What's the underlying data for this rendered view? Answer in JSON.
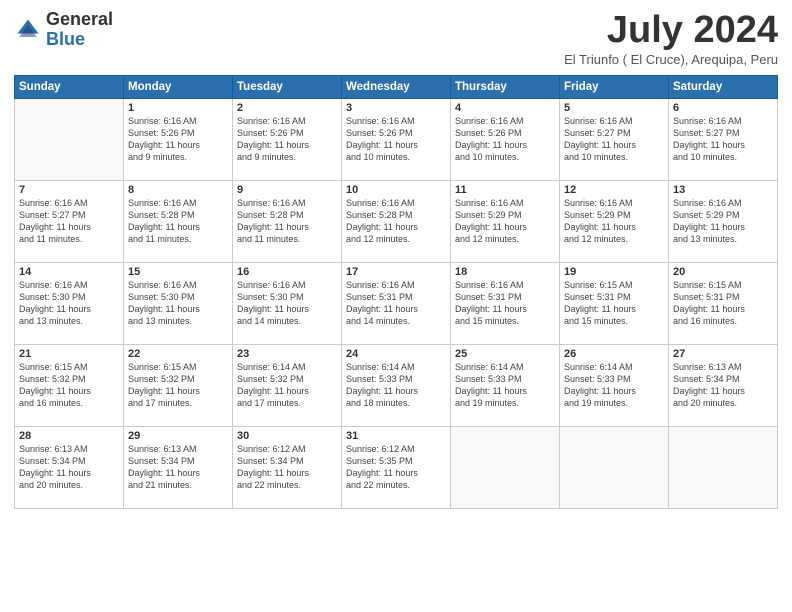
{
  "logo": {
    "general": "General",
    "blue": "Blue"
  },
  "title": "July 2024",
  "location": "El Triunfo ( El Cruce), Arequipa, Peru",
  "headers": [
    "Sunday",
    "Monday",
    "Tuesday",
    "Wednesday",
    "Thursday",
    "Friday",
    "Saturday"
  ],
  "weeks": [
    [
      {
        "day": "",
        "info": ""
      },
      {
        "day": "1",
        "info": "Sunrise: 6:16 AM\nSunset: 5:26 PM\nDaylight: 11 hours\nand 9 minutes."
      },
      {
        "day": "2",
        "info": "Sunrise: 6:16 AM\nSunset: 5:26 PM\nDaylight: 11 hours\nand 9 minutes."
      },
      {
        "day": "3",
        "info": "Sunrise: 6:16 AM\nSunset: 5:26 PM\nDaylight: 11 hours\nand 10 minutes."
      },
      {
        "day": "4",
        "info": "Sunrise: 6:16 AM\nSunset: 5:26 PM\nDaylight: 11 hours\nand 10 minutes."
      },
      {
        "day": "5",
        "info": "Sunrise: 6:16 AM\nSunset: 5:27 PM\nDaylight: 11 hours\nand 10 minutes."
      },
      {
        "day": "6",
        "info": "Sunrise: 6:16 AM\nSunset: 5:27 PM\nDaylight: 11 hours\nand 10 minutes."
      }
    ],
    [
      {
        "day": "7",
        "info": "Sunrise: 6:16 AM\nSunset: 5:27 PM\nDaylight: 11 hours\nand 11 minutes."
      },
      {
        "day": "8",
        "info": "Sunrise: 6:16 AM\nSunset: 5:28 PM\nDaylight: 11 hours\nand 11 minutes."
      },
      {
        "day": "9",
        "info": "Sunrise: 6:16 AM\nSunset: 5:28 PM\nDaylight: 11 hours\nand 11 minutes."
      },
      {
        "day": "10",
        "info": "Sunrise: 6:16 AM\nSunset: 5:28 PM\nDaylight: 11 hours\nand 12 minutes."
      },
      {
        "day": "11",
        "info": "Sunrise: 6:16 AM\nSunset: 5:29 PM\nDaylight: 11 hours\nand 12 minutes."
      },
      {
        "day": "12",
        "info": "Sunrise: 6:16 AM\nSunset: 5:29 PM\nDaylight: 11 hours\nand 12 minutes."
      },
      {
        "day": "13",
        "info": "Sunrise: 6:16 AM\nSunset: 5:29 PM\nDaylight: 11 hours\nand 13 minutes."
      }
    ],
    [
      {
        "day": "14",
        "info": "Sunrise: 6:16 AM\nSunset: 5:30 PM\nDaylight: 11 hours\nand 13 minutes."
      },
      {
        "day": "15",
        "info": "Sunrise: 6:16 AM\nSunset: 5:30 PM\nDaylight: 11 hours\nand 13 minutes."
      },
      {
        "day": "16",
        "info": "Sunrise: 6:16 AM\nSunset: 5:30 PM\nDaylight: 11 hours\nand 14 minutes."
      },
      {
        "day": "17",
        "info": "Sunrise: 6:16 AM\nSunset: 5:31 PM\nDaylight: 11 hours\nand 14 minutes."
      },
      {
        "day": "18",
        "info": "Sunrise: 6:16 AM\nSunset: 5:31 PM\nDaylight: 11 hours\nand 15 minutes."
      },
      {
        "day": "19",
        "info": "Sunrise: 6:15 AM\nSunset: 5:31 PM\nDaylight: 11 hours\nand 15 minutes."
      },
      {
        "day": "20",
        "info": "Sunrise: 6:15 AM\nSunset: 5:31 PM\nDaylight: 11 hours\nand 16 minutes."
      }
    ],
    [
      {
        "day": "21",
        "info": "Sunrise: 6:15 AM\nSunset: 5:32 PM\nDaylight: 11 hours\nand 16 minutes."
      },
      {
        "day": "22",
        "info": "Sunrise: 6:15 AM\nSunset: 5:32 PM\nDaylight: 11 hours\nand 17 minutes."
      },
      {
        "day": "23",
        "info": "Sunrise: 6:14 AM\nSunset: 5:32 PM\nDaylight: 11 hours\nand 17 minutes."
      },
      {
        "day": "24",
        "info": "Sunrise: 6:14 AM\nSunset: 5:33 PM\nDaylight: 11 hours\nand 18 minutes."
      },
      {
        "day": "25",
        "info": "Sunrise: 6:14 AM\nSunset: 5:33 PM\nDaylight: 11 hours\nand 19 minutes."
      },
      {
        "day": "26",
        "info": "Sunrise: 6:14 AM\nSunset: 5:33 PM\nDaylight: 11 hours\nand 19 minutes."
      },
      {
        "day": "27",
        "info": "Sunrise: 6:13 AM\nSunset: 5:34 PM\nDaylight: 11 hours\nand 20 minutes."
      }
    ],
    [
      {
        "day": "28",
        "info": "Sunrise: 6:13 AM\nSunset: 5:34 PM\nDaylight: 11 hours\nand 20 minutes."
      },
      {
        "day": "29",
        "info": "Sunrise: 6:13 AM\nSunset: 5:34 PM\nDaylight: 11 hours\nand 21 minutes."
      },
      {
        "day": "30",
        "info": "Sunrise: 6:12 AM\nSunset: 5:34 PM\nDaylight: 11 hours\nand 22 minutes."
      },
      {
        "day": "31",
        "info": "Sunrise: 6:12 AM\nSunset: 5:35 PM\nDaylight: 11 hours\nand 22 minutes."
      },
      {
        "day": "",
        "info": ""
      },
      {
        "day": "",
        "info": ""
      },
      {
        "day": "",
        "info": ""
      }
    ]
  ]
}
